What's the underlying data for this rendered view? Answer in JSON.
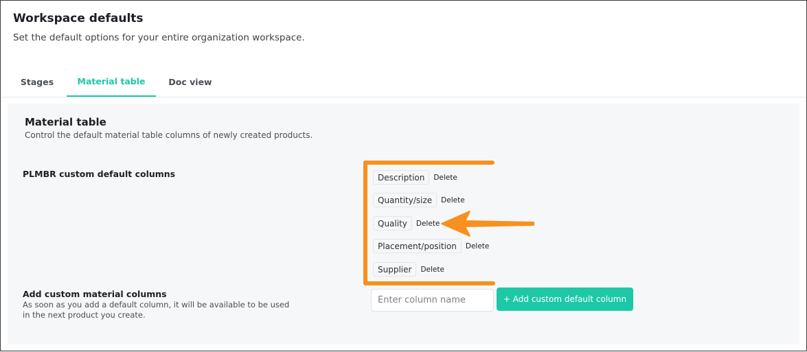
{
  "header": {
    "title": "Workspace defaults",
    "subtitle": "Set the default options for your entire organization workspace."
  },
  "tabs": [
    {
      "label": "Stages",
      "active": false
    },
    {
      "label": "Material table",
      "active": true
    },
    {
      "label": "Doc view",
      "active": false
    }
  ],
  "section": {
    "title": "Material table",
    "description": "Control the default material table columns of newly created products."
  },
  "custom_columns": {
    "label": "PLMBR custom default columns",
    "delete_label": "Delete",
    "items": [
      "Description",
      "Quantity/size",
      "Quality",
      "Placement/position",
      "Supplier"
    ]
  },
  "add_columns": {
    "label": "Add custom material columns",
    "description": "As soon as you add a default column, it will be available to be used in the next product you create.",
    "input_placeholder": "Enter column name",
    "input_value": "",
    "button_label": "+ Add custom default column"
  },
  "annotation": {
    "color": "#f7901e",
    "icons": [
      "bracket-highlight",
      "arrow-pointer"
    ]
  },
  "colors": {
    "accent": "#1dc8a8",
    "panel_bg": "#f6f7f8"
  }
}
